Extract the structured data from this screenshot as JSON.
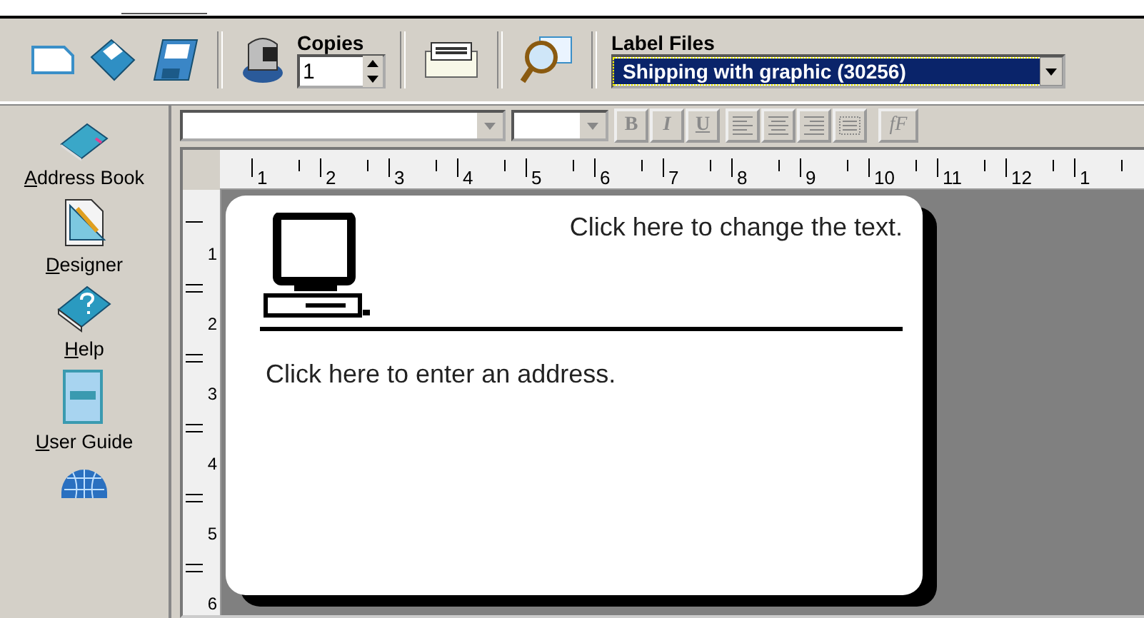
{
  "toolbar": {
    "copies": {
      "label": "Copies",
      "value": "1"
    },
    "label_files": {
      "label": "Label Files",
      "value": "Shipping with graphic (30256)"
    }
  },
  "format_bar": {
    "disabled": true,
    "style_buttons": [
      "B",
      "I",
      "U"
    ],
    "font_button": "fF"
  },
  "sidebar": {
    "items": [
      {
        "label": "Address Book"
      },
      {
        "label": "Designer"
      },
      {
        "label": "Help"
      },
      {
        "label": "User Guide"
      }
    ]
  },
  "ruler": {
    "horizontal": [
      "1",
      "2",
      "3",
      "4",
      "5",
      "6",
      "7",
      "8",
      "9",
      "10",
      "11",
      "12",
      "1"
    ],
    "vertical": [
      "1",
      "2",
      "3",
      "4",
      "5",
      "6"
    ]
  },
  "label": {
    "text": "Click here to change the text.",
    "address": "Click here to enter an address."
  }
}
